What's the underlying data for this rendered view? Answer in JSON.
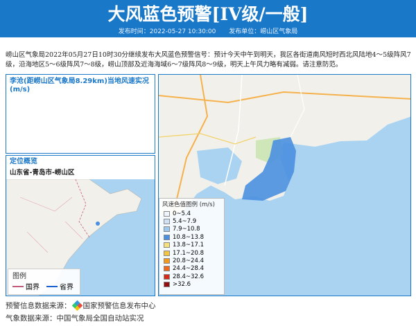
{
  "header": {
    "title": "大风蓝色预警[IV级/一般]",
    "publish_time_label": "发布时间：2022-05-27 10:30:00",
    "publisher_label": "发布单位：崂山区气象局"
  },
  "summary": "崂山区气象局2022年05月27日10时30分继续发布大风蓝色预警信号：预计今天中午到明天，我区各街道南风短时西北风陆地4～5级阵风7级，沿海地区5～6级阵风7～8级，崂山顶部及近海海域6～7级阵风8～9级，明天上午风力略有减弱。请注意防范。",
  "station_panel": {
    "title": "李沧(距崂山区气象局8.29km)当地风速实况(m/s)"
  },
  "location_panel": {
    "title": "定位概览",
    "location": "山东省-青岛市-崂山区"
  },
  "map_legend": {
    "title": "图例",
    "items": [
      {
        "label": "国界",
        "color": "#c45a7a"
      },
      {
        "label": "省界",
        "color": "#1a5fd0"
      }
    ]
  },
  "wind_legend": {
    "title": "风速色值图例 (m/s)",
    "items": [
      {
        "label": "0~5.4",
        "color": "#eef4fb"
      },
      {
        "label": "5.4~7.9",
        "color": "#cfe2f5"
      },
      {
        "label": "7.9~10.8",
        "color": "#9ec8ee"
      },
      {
        "label": "10.8~13.8",
        "color": "#4a8fe0"
      },
      {
        "label": "13.8~17.1",
        "color": "#f7e07a"
      },
      {
        "label": "17.1~20.8",
        "color": "#f4c542"
      },
      {
        "label": "20.8~24.4",
        "color": "#f39a1c"
      },
      {
        "label": "24.4~28.4",
        "color": "#ef6a1a"
      },
      {
        "label": "28.4~32.6",
        "color": "#d42a1a"
      },
      {
        "label": ">32.6",
        "color": "#8f0f12"
      }
    ]
  },
  "footer": {
    "line1": "预警信息数据来源：",
    "source1": "国家预警信息发布中心",
    "line2": "气象数据来源：中国气象局全国自动站实况"
  },
  "colors": {
    "brand": "#1a78c9",
    "land": "#f2f0ea",
    "sea": "#aad3f2",
    "warning_area": "#4a8fe0"
  }
}
